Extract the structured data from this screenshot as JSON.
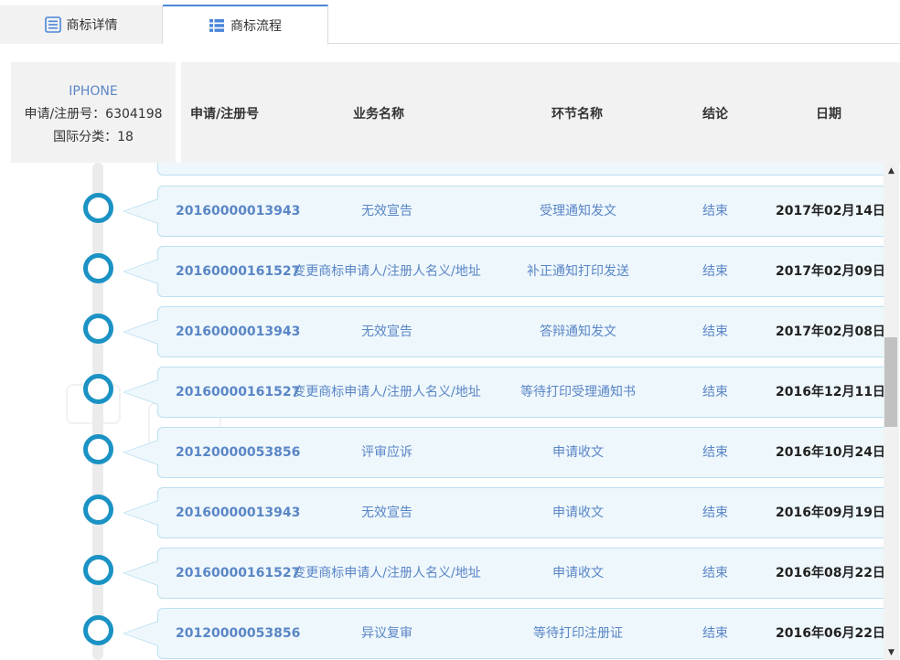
{
  "tabs": [
    {
      "label": "商标详情",
      "icon": "list-document-icon"
    },
    {
      "label": "商标流程",
      "icon": "grid-list-icon"
    }
  ],
  "info": {
    "name": "IPHONE",
    "reg_line": "申请/注册号：6304198",
    "class_line": "国际分类：18"
  },
  "header": {
    "reg_no": "申请/注册号",
    "business": "业务名称",
    "step": "环节名称",
    "result": "结论",
    "date": "日期"
  },
  "rows": [
    {
      "no": "20160000013943",
      "business": "无效宣告",
      "step": "受理通知发文",
      "result": "结束",
      "date": "2017年02月14日"
    },
    {
      "no": "20160000161527",
      "business": "变更商标申请人/注册人名义/地址",
      "step": "补正通知打印发送",
      "result": "结束",
      "date": "2017年02月09日"
    },
    {
      "no": "20160000013943",
      "business": "无效宣告",
      "step": "答辩通知发文",
      "result": "结束",
      "date": "2017年02月08日"
    },
    {
      "no": "20160000161527",
      "business": "变更商标申请人/注册人名义/地址",
      "step": "等待打印受理通知书",
      "result": "结束",
      "date": "2016年12月11日"
    },
    {
      "no": "20120000053856",
      "business": "评审应诉",
      "step": "申请收文",
      "result": "结束",
      "date": "2016年10月24日"
    },
    {
      "no": "20160000013943",
      "business": "无效宣告",
      "step": "申请收文",
      "result": "结束",
      "date": "2016年09月19日"
    },
    {
      "no": "20160000161527",
      "business": "变更商标申请人/注册人名义/地址",
      "step": "申请收文",
      "result": "结束",
      "date": "2016年08月22日"
    },
    {
      "no": "20120000053856",
      "business": "异议复审",
      "step": "等待打印注册证",
      "result": "结束",
      "date": "2016年06月22日"
    }
  ],
  "colors": {
    "accent": "#1b92c4",
    "link_text": "#5a86c6",
    "bubble_bg": "#eef7fc",
    "bubble_border": "#bcdff0",
    "tab_active_border": "#4a86d8"
  }
}
